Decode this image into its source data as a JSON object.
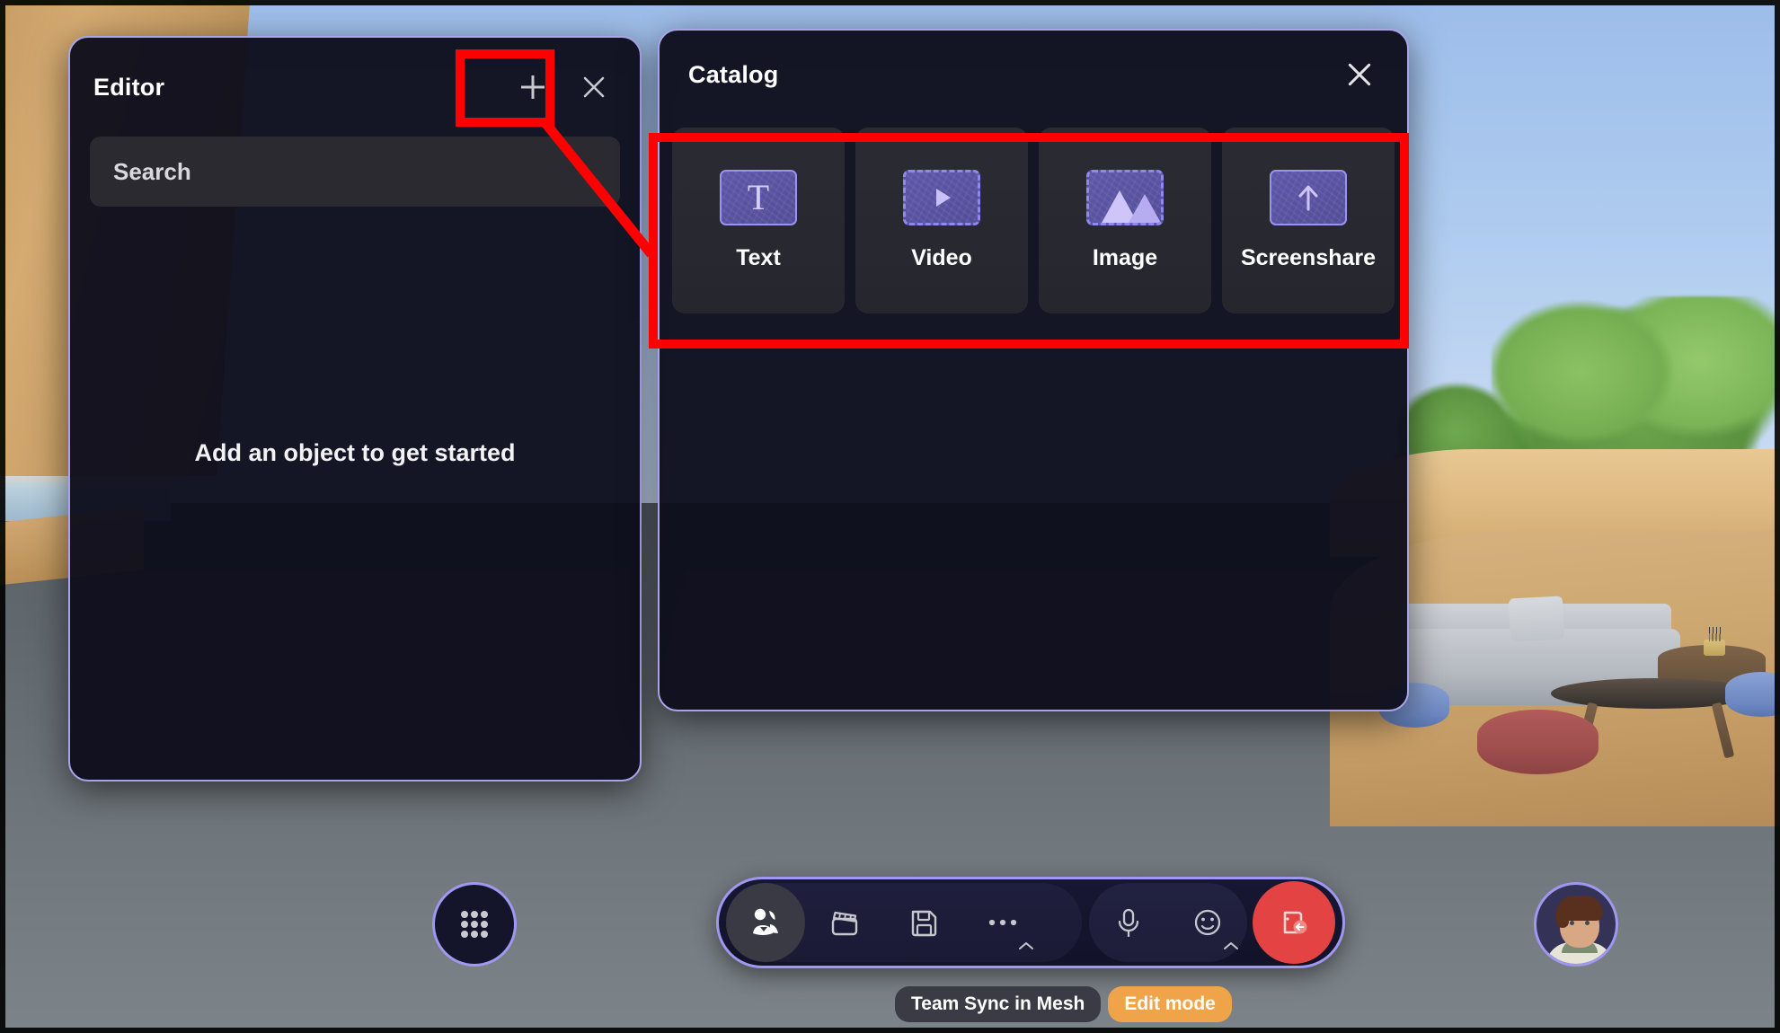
{
  "app": {
    "session_label": "Team Sync in Mesh",
    "mode_label": "Edit mode",
    "accent_border": "#a9a4ea",
    "annotation_color": "#ff0000",
    "edit_mode_color": "#f0a44a",
    "leave_button_color": "#e34343"
  },
  "editor_panel": {
    "title": "Editor",
    "add_button_label": "+",
    "close_button_label": "✕",
    "search": {
      "value": "",
      "placeholder": "Search",
      "display_text": "Search"
    },
    "empty_state": "Add an object to get started"
  },
  "catalog_panel": {
    "title": "Catalog",
    "close_button_label": "✕",
    "items": [
      {
        "label": "Text",
        "icon": "text-tile-icon",
        "glyph": "T",
        "tile_style": "solid"
      },
      {
        "label": "Video",
        "icon": "video-tile-icon",
        "glyph": "▶",
        "tile_style": "dashed"
      },
      {
        "label": "Image",
        "icon": "image-tile-icon",
        "glyph": "mountains",
        "tile_style": "dashed"
      },
      {
        "label": "Screenshare",
        "icon": "screenshare-tile-icon",
        "glyph": "↑",
        "tile_style": "solid"
      }
    ]
  },
  "toolbar": {
    "apps_button": {
      "name": "apps-grid-button",
      "icon": "grid-dots-icon"
    },
    "buttons": [
      {
        "name": "people-button",
        "icon": "people-icon",
        "active": true,
        "chevron": false
      },
      {
        "name": "video-button",
        "icon": "clapperboard-icon",
        "active": false,
        "chevron": false
      },
      {
        "name": "save-button",
        "icon": "floppy-disk-icon",
        "active": false,
        "chevron": false
      },
      {
        "name": "more-button",
        "icon": "ellipsis-icon",
        "active": false,
        "chevron": true
      },
      {
        "name": "mic-button",
        "icon": "microphone-icon",
        "active": false,
        "chevron": false
      },
      {
        "name": "reactions-button",
        "icon": "smiley-icon",
        "active": false,
        "chevron": true
      }
    ],
    "leave_button": {
      "name": "leave-button",
      "icon": "leave-door-icon"
    }
  },
  "avatar": {
    "name": "user-avatar",
    "alt": "avatar"
  }
}
